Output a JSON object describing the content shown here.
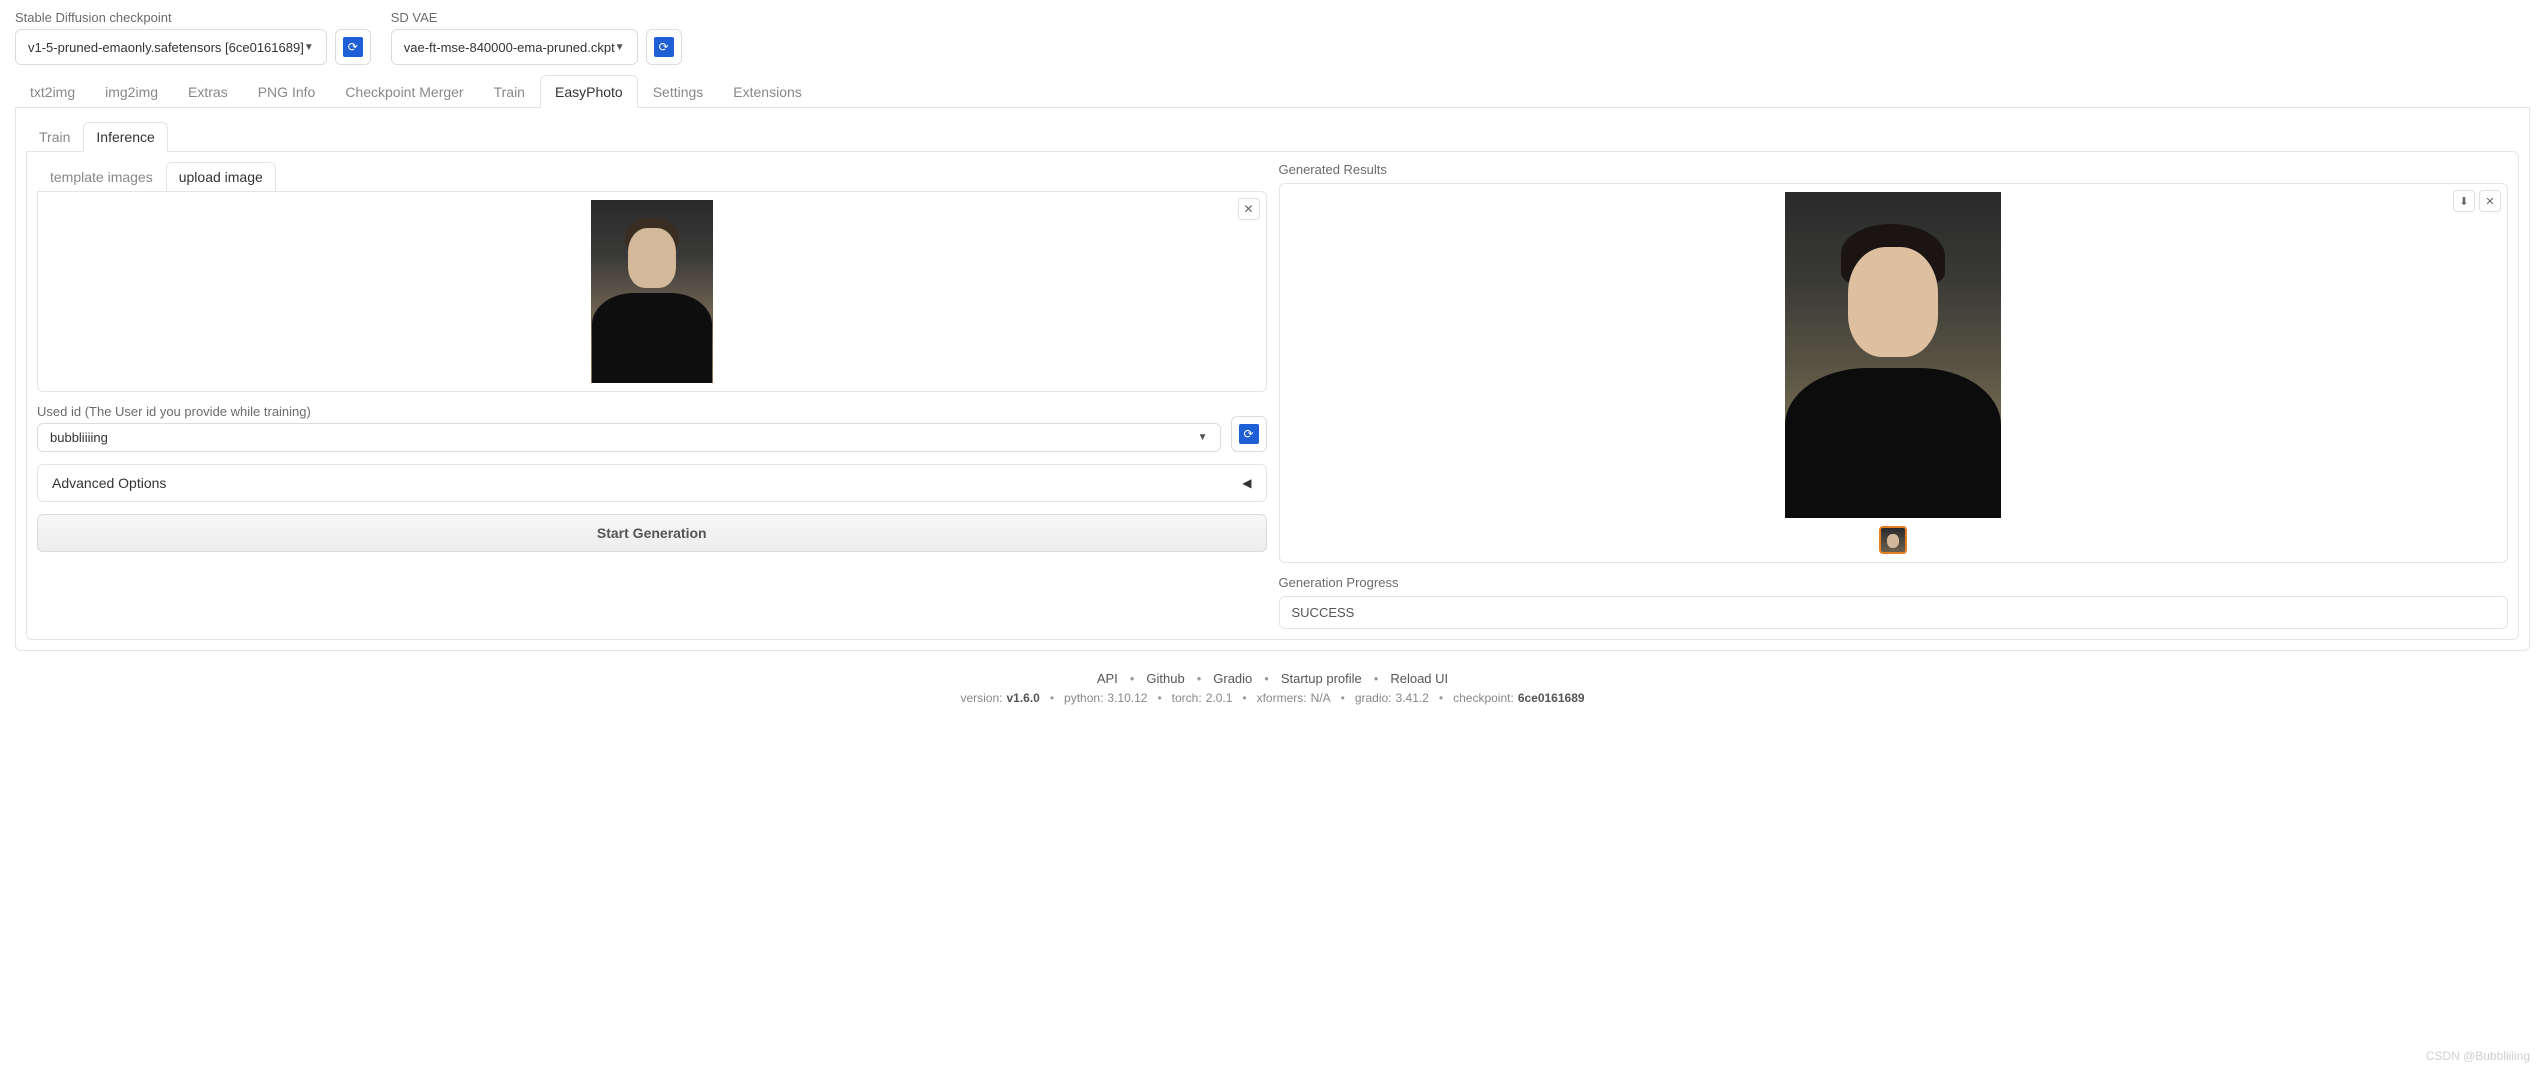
{
  "top": {
    "checkpoint_label": "Stable Diffusion checkpoint",
    "checkpoint_value": "v1-5-pruned-emaonly.safetensors [6ce0161689]",
    "vae_label": "SD VAE",
    "vae_value": "vae-ft-mse-840000-ema-pruned.ckpt"
  },
  "main_tabs": [
    "txt2img",
    "img2img",
    "Extras",
    "PNG Info",
    "Checkpoint Merger",
    "Train",
    "EasyPhoto",
    "Settings",
    "Extensions"
  ],
  "main_active": "EasyPhoto",
  "easy_tabs": [
    "Train",
    "Inference"
  ],
  "easy_active": "Inference",
  "inner_tabs": [
    "template images",
    "upload image"
  ],
  "inner_active": "upload image",
  "used_id": {
    "label": "Used id (The User id you provide while training)",
    "value": "bubbliiiing"
  },
  "advanced": {
    "label": "Advanced Options"
  },
  "start_btn": "Start Generation",
  "results": {
    "label": "Generated Results"
  },
  "progress": {
    "label": "Generation Progress",
    "value": "SUCCESS"
  },
  "footer": {
    "links": [
      "API",
      "Github",
      "Gradio",
      "Startup profile",
      "Reload UI"
    ],
    "version_label": "version:",
    "version": "v1.6.0",
    "python_label": "python:",
    "python": "3.10.12",
    "torch_label": "torch:",
    "torch": "2.0.1",
    "xformers_label": "xformers:",
    "xformers": "N/A",
    "gradio_label": "gradio:",
    "gradio": "3.41.2",
    "checkpoint_label": "checkpoint:",
    "checkpoint": "6ce0161689"
  },
  "watermark": "CSDN @Bubbliiiing"
}
